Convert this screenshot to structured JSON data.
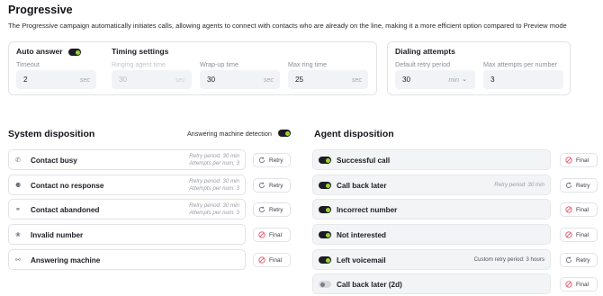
{
  "header": {
    "title": "Progressive",
    "description": "The Progressive campaign automatically initiates calls, allowing agents to connect with contacts who are already on the line, making it a more efficient option compared to Preview mode"
  },
  "auto_answer": {
    "label": "Auto answer",
    "enabled": true,
    "timeout_label": "Timeout",
    "timeout_value": "2",
    "timeout_unit": "sec"
  },
  "timing": {
    "label": "Timing settings",
    "ringing_label": "Ringing agent time",
    "ringing_value": "30",
    "ringing_unit": "sec",
    "wrapup_label": "Wrap-up time",
    "wrapup_value": "30",
    "wrapup_unit": "sec",
    "maxring_label": "Max ring time",
    "maxring_value": "25",
    "maxring_unit": "sec"
  },
  "dialing": {
    "label": "Dialing attempts",
    "retry_label": "Default retry period",
    "retry_value": "30",
    "retry_unit": "min",
    "max_label": "Max attempts per number",
    "max_value": "3"
  },
  "system": {
    "title": "System disposition",
    "amd_label": "Answering machine detection",
    "amd_enabled": true,
    "rows": [
      {
        "label": "Contact busy",
        "icon": "phone-busy-icon",
        "note1": "Retry period: 30 min",
        "note2": "Attempts per num: 3",
        "action": "Retry"
      },
      {
        "label": "Contact no response",
        "icon": "no-response-icon",
        "note1": "Retry period: 30 min",
        "note2": "Attempts per num: 3",
        "action": "Retry"
      },
      {
        "label": "Contact abandoned",
        "icon": "abandoned-icon",
        "note1": "Retry period: 30 min",
        "note2": "Attempts per num: 3",
        "action": "Retry"
      },
      {
        "label": "Invalid number",
        "icon": "invalid-number-icon",
        "action": "Final"
      },
      {
        "label": "Answering machine",
        "icon": "voicemail-icon",
        "action": "Final"
      }
    ]
  },
  "agent": {
    "title": "Agent disposition",
    "rows": [
      {
        "label": "Successful call",
        "enabled": true,
        "note": "",
        "action": "Final"
      },
      {
        "label": "Call back later",
        "enabled": true,
        "note": "Retry period: 30 min",
        "action": "Retry"
      },
      {
        "label": "Incorrect number",
        "enabled": true,
        "note": "",
        "action": "Final"
      },
      {
        "label": "Not interested",
        "enabled": true,
        "note": "",
        "action": "Final"
      },
      {
        "label": "Left voicemail",
        "enabled": true,
        "note": "Custom retry period: 3 hours",
        "action": "Retry"
      },
      {
        "label": "Call back later (2d)",
        "enabled": false,
        "note": "",
        "action": "Final"
      }
    ]
  },
  "colors": {
    "toggle_track": "#1c1c24",
    "toggle_knob": "#9bd430",
    "final_icon": "#e0566a",
    "retry_icon": "#6f717b"
  }
}
